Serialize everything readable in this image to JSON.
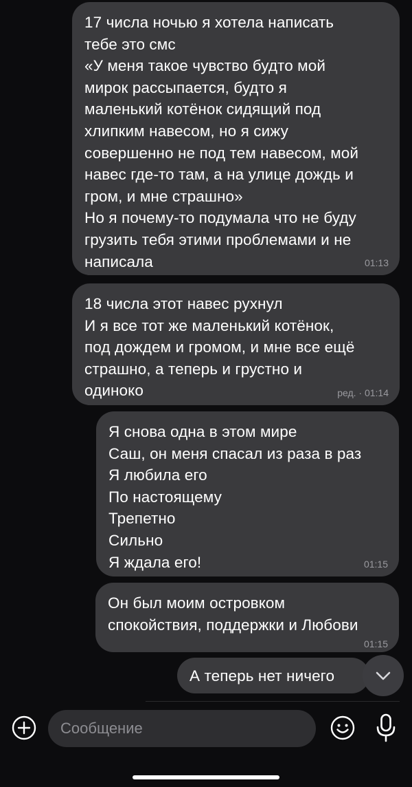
{
  "messages": [
    {
      "text": "17 числа ночью я хотела написать\nтебе это смс\n«У меня такое чувство будто мой\nмирок рассыпается, будто я\nмаленький котёнок сидящий под\nхлипким навесом, но я сижу\nсовершенно не под тем навесом, мой\nнавес где-то там, а на улице дождь и\nгром, и мне страшно»\nНо я почему-то подумала что не буду\nгрузить тебя этими проблемами и не\nнаписала",
      "time": "01:13"
    },
    {
      "text": "18 числа этот навес рухнул\nИ я все тот же маленький котёнок,\nпод дождем и громом, и мне все ещё\nстрашно, а теперь и грустно и\nодиноко",
      "time": "ред. · 01:14"
    },
    {
      "text": "Я снова одна в этом мире\nСаш, он меня спасал из раза в раз\nЯ любила его\nПо настоящему\nТрепетно\nСильно\nЯ ждала его!",
      "time": "01:15"
    },
    {
      "text": "Он был моим островком\nспокойствия, поддержки и Любови",
      "time": "01:15"
    },
    {
      "text": "А теперь нет ничего",
      "time": ""
    }
  ],
  "composer": {
    "placeholder": "Сообщение"
  },
  "icons": {
    "add": "plus-circle-icon",
    "emoji": "smiley-icon",
    "mic": "microphone-icon",
    "scroll_down": "chevron-down-icon"
  },
  "colors": {
    "background": "#0c0c0e",
    "bubble": "#3a3a3d",
    "input": "#2e2e31",
    "timestamp": "#9a9a9f"
  }
}
